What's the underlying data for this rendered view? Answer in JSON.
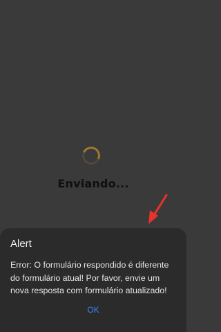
{
  "loading": {
    "text": "Enviando..."
  },
  "alert": {
    "title": "Alert",
    "message": "Error: O formulário respondido é diferente do formulário atual! Por favor, envie um nova resposta com formulário atualizado!",
    "ok_label": "OK"
  },
  "colors": {
    "background": "#3a3a3a",
    "dialog": "#2b2b2b",
    "spinner": "#a0782f",
    "ok_text": "#3b86f0",
    "annotation_arrow": "#e8332a"
  },
  "icons": {
    "spinner": "loading-spinner-icon",
    "annotation": "red-arrow-annotation-icon"
  }
}
